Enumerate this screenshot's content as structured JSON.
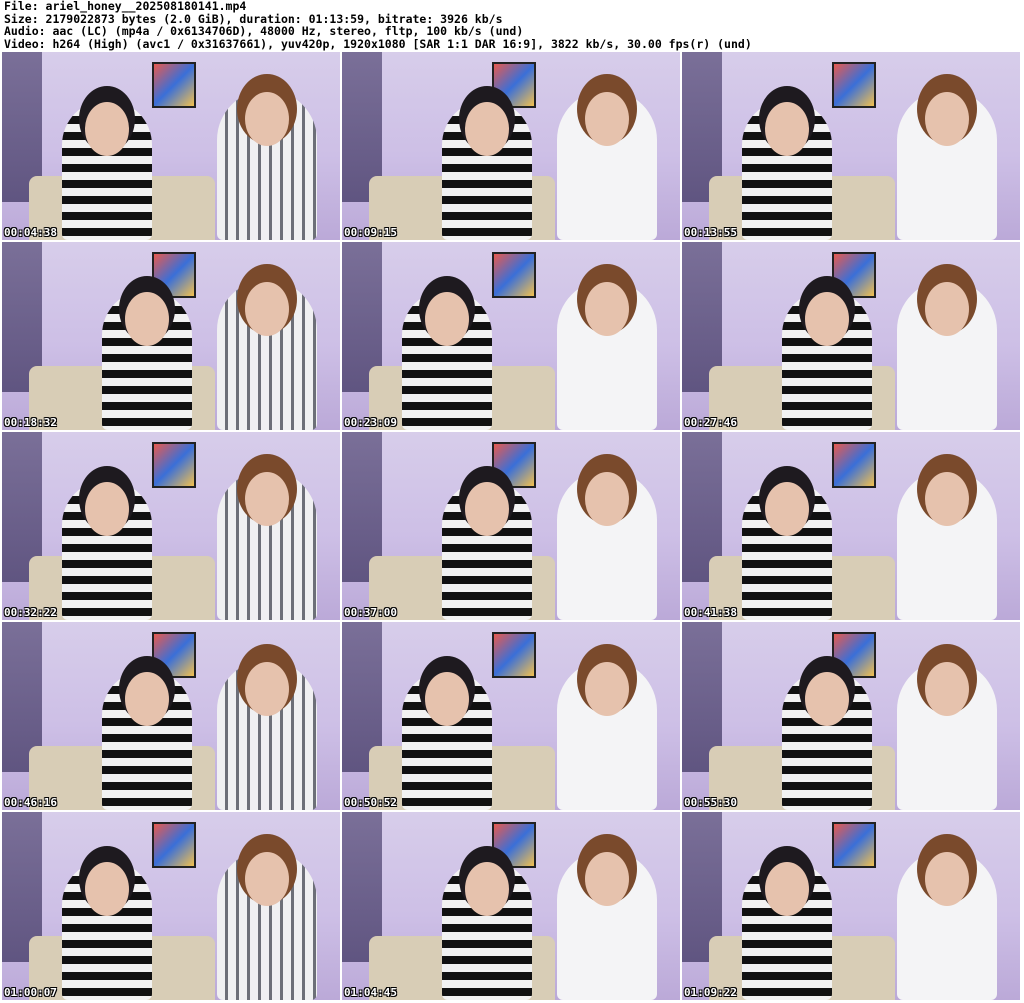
{
  "header": {
    "file": "File: ariel_honey__202508180141.mp4",
    "size": "Size: 2179022873 bytes (2.0 GiB), duration: 01:13:59, bitrate: 3926 kb/s",
    "audio": "Audio: aac (LC) (mp4a / 0x6134706D), 48000 Hz, stereo, fltp, 100 kb/s (und)",
    "video": "Video: h264 (High) (avc1 / 0x31637661), yuv420p, 1920x1080 [SAR 1:1 DAR 16:9], 3822 kb/s, 30.00 fps(r) (und)"
  },
  "thumbnails": [
    {
      "timestamp": "00:04:38"
    },
    {
      "timestamp": "00:09:15"
    },
    {
      "timestamp": "00:13:55"
    },
    {
      "timestamp": "00:18:32"
    },
    {
      "timestamp": "00:23:09"
    },
    {
      "timestamp": "00:27:46"
    },
    {
      "timestamp": "00:32:22"
    },
    {
      "timestamp": "00:37:00"
    },
    {
      "timestamp": "00:41:38"
    },
    {
      "timestamp": "00:46:16"
    },
    {
      "timestamp": "00:50:52"
    },
    {
      "timestamp": "00:55:30"
    },
    {
      "timestamp": "01:00:07"
    },
    {
      "timestamp": "01:04:45"
    },
    {
      "timestamp": "01:09:22"
    }
  ]
}
